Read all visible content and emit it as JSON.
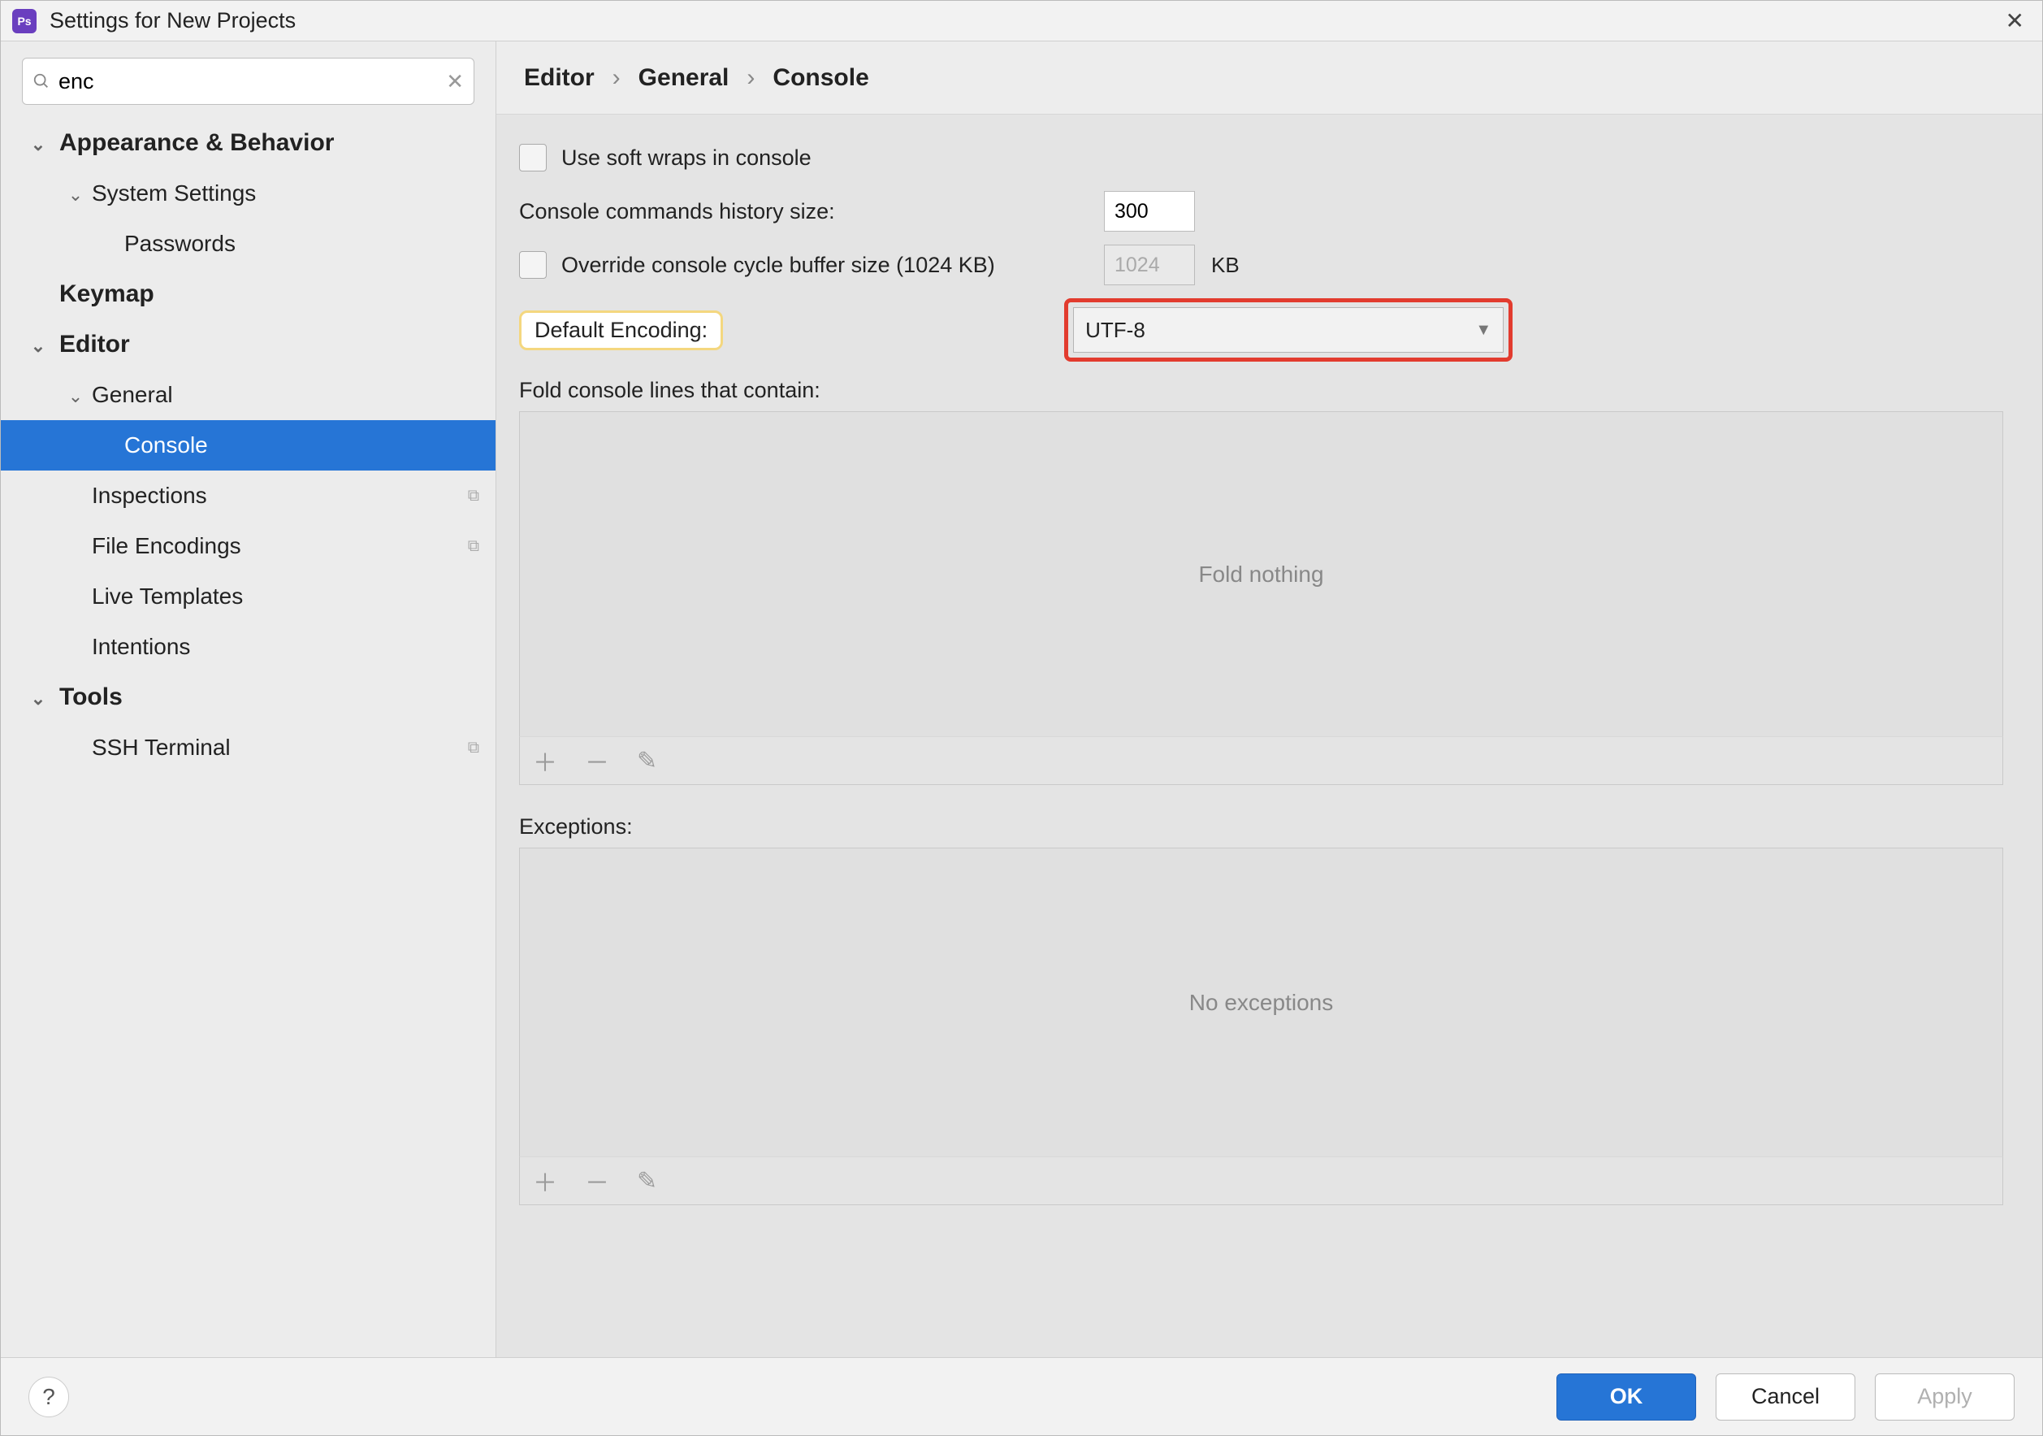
{
  "window": {
    "title": "Settings for New Projects"
  },
  "search": {
    "value": "enc"
  },
  "sidebar": {
    "items": [
      {
        "label": "Appearance & Behavior"
      },
      {
        "label": "System Settings"
      },
      {
        "label": "Passwords"
      },
      {
        "label": "Keymap"
      },
      {
        "label": "Editor"
      },
      {
        "label": "General"
      },
      {
        "label": "Console"
      },
      {
        "label": "Inspections"
      },
      {
        "label": "File Encodings"
      },
      {
        "label": "Live Templates"
      },
      {
        "label": "Intentions"
      },
      {
        "label": "Tools"
      },
      {
        "label": "SSH Terminal"
      }
    ]
  },
  "breadcrumb": {
    "a": "Editor",
    "b": "General",
    "c": "Console"
  },
  "settings": {
    "softWraps": {
      "label": "Use soft wraps in console",
      "checked": false
    },
    "historySize": {
      "label": "Console commands history size:",
      "value": "300"
    },
    "overrideBuffer": {
      "label": "Override console cycle buffer size (1024 KB)",
      "checked": false,
      "value": "1024",
      "unit": "KB"
    },
    "defaultEncoding": {
      "label": "Default Encoding:",
      "value": "UTF-8"
    },
    "foldSection": {
      "label": "Fold console lines that contain:",
      "placeholder": "Fold nothing"
    },
    "exceptionsSection": {
      "label": "Exceptions:",
      "placeholder": "No exceptions"
    }
  },
  "footer": {
    "ok": "OK",
    "cancel": "Cancel",
    "apply": "Apply"
  }
}
